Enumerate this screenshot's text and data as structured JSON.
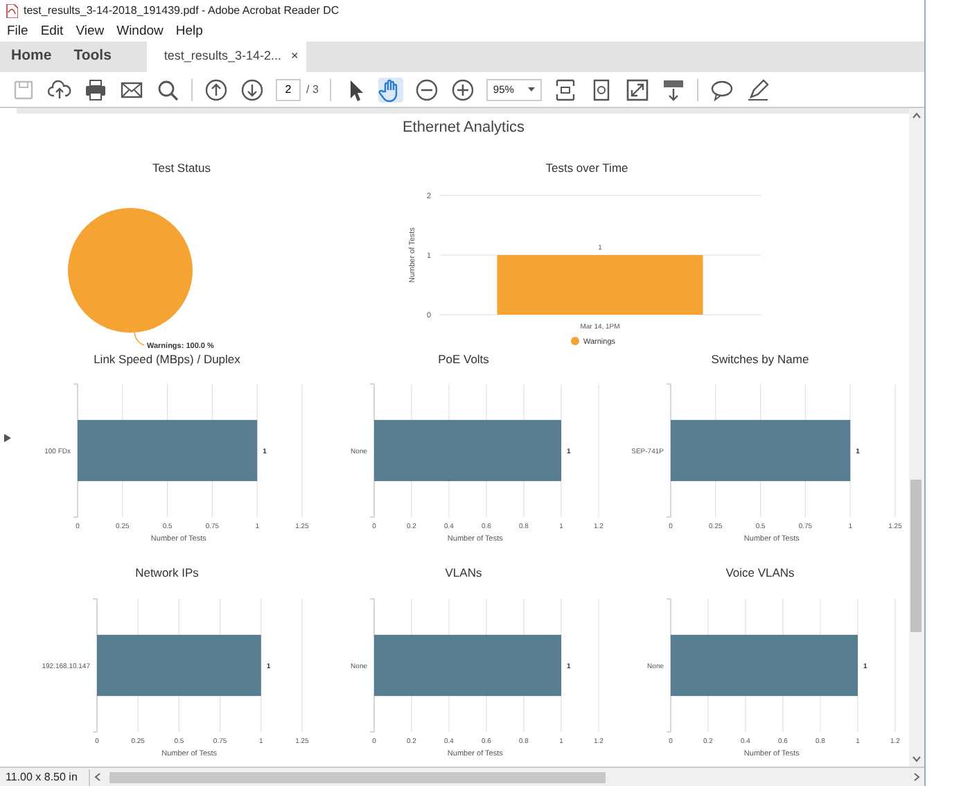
{
  "window": {
    "title": "test_results_3-14-2018_191439.pdf - Adobe Acrobat Reader DC"
  },
  "menu": [
    "File",
    "Edit",
    "View",
    "Window",
    "Help"
  ],
  "tabs": [
    {
      "label": "Home",
      "selected": false,
      "kind": "nav"
    },
    {
      "label": "Tools",
      "selected": false,
      "kind": "nav"
    },
    {
      "label": "test_results_3-14-2...",
      "selected": true,
      "kind": "document",
      "close": "×"
    }
  ],
  "toolbar": {
    "save_disabled": true,
    "hand_selected": true,
    "page_number": "2",
    "page_total": "/ 3",
    "zoom": "95%"
  },
  "document": {
    "heading": "Ethernet Analytics",
    "charts": [
      {
        "chart_data": {
          "type": "pie",
          "title": "Test Status",
          "series": [
            {
              "color": "#f5a333",
              "values": [
                100
              ]
            }
          ],
          "value_labels": [
            "Warnings: 100.0 %"
          ]
        }
      },
      {
        "chart_data": {
          "type": "bar",
          "title": "Tests over Time",
          "categories": [
            "Mar 14, 1PM"
          ],
          "ylabel": "Number of Tests",
          "ylim": [
            0,
            2
          ],
          "yticks": [
            0,
            1,
            2
          ],
          "series": [
            {
              "name": "Warnings",
              "color": "#f5a333",
              "values": [
                1
              ]
            }
          ],
          "data_labels": true,
          "grid": true
        }
      },
      {
        "chart_data": {
          "type": "bar",
          "orientation": "horizontal",
          "title": "Link Speed (MBps) / Duplex",
          "categories": [
            "100 FDx"
          ],
          "xlabel": "Number of Tests",
          "xlim": [
            0,
            1.25
          ],
          "xticks": [
            0,
            0.25,
            0.5,
            0.75,
            1,
            1.25
          ],
          "series": [
            {
              "color": "#587d91",
              "values": [
                1
              ]
            }
          ],
          "data_labels": true,
          "grid": true
        }
      },
      {
        "chart_data": {
          "type": "bar",
          "orientation": "horizontal",
          "title": "PoE Volts",
          "categories": [
            "None"
          ],
          "xlabel": "Number of Tests",
          "xlim": [
            0,
            1.2
          ],
          "xticks": [
            0,
            0.2,
            0.4,
            0.6,
            0.8,
            1,
            1.2
          ],
          "series": [
            {
              "color": "#587d91",
              "values": [
                1
              ]
            }
          ],
          "data_labels": true,
          "grid": true
        }
      },
      {
        "chart_data": {
          "type": "bar",
          "orientation": "horizontal",
          "title": "Switches by Name",
          "categories": [
            "SEP-741P"
          ],
          "xlabel": "Number of Tests",
          "xlim": [
            0,
            1.25
          ],
          "xticks": [
            0,
            0.25,
            0.5,
            0.75,
            1,
            1.25
          ],
          "series": [
            {
              "color": "#587d91",
              "values": [
                1
              ]
            }
          ],
          "data_labels": true,
          "grid": true
        }
      },
      {
        "chart_data": {
          "type": "bar",
          "orientation": "horizontal",
          "title": "Network IPs",
          "categories": [
            "192.168.10.147"
          ],
          "xlabel": "Number of Tests",
          "xlim": [
            0,
            1.25
          ],
          "xticks": [
            0,
            0.25,
            0.5,
            0.75,
            1,
            1.25
          ],
          "series": [
            {
              "color": "#587d91",
              "values": [
                1
              ]
            }
          ],
          "data_labels": true,
          "grid": true
        }
      },
      {
        "chart_data": {
          "type": "bar",
          "orientation": "horizontal",
          "title": "VLANs",
          "categories": [
            "None"
          ],
          "xlabel": "Number of Tests",
          "xlim": [
            0,
            1.2
          ],
          "xticks": [
            0,
            0.2,
            0.4,
            0.6,
            0.8,
            1,
            1.2
          ],
          "series": [
            {
              "color": "#587d91",
              "values": [
                1
              ]
            }
          ],
          "data_labels": true,
          "grid": true
        }
      },
      {
        "chart_data": {
          "type": "bar",
          "orientation": "horizontal",
          "title": "Voice VLANs",
          "categories": [
            "None"
          ],
          "xlabel": "Number of Tests",
          "xlim": [
            0,
            1.2
          ],
          "xticks": [
            0,
            0.2,
            0.4,
            0.6,
            0.8,
            1,
            1.2
          ],
          "series": [
            {
              "color": "#587d91",
              "values": [
                1
              ]
            }
          ],
          "data_labels": true,
          "grid": true
        }
      }
    ]
  },
  "status_bar": {
    "page_size": "11.00 x 8.50 in"
  }
}
